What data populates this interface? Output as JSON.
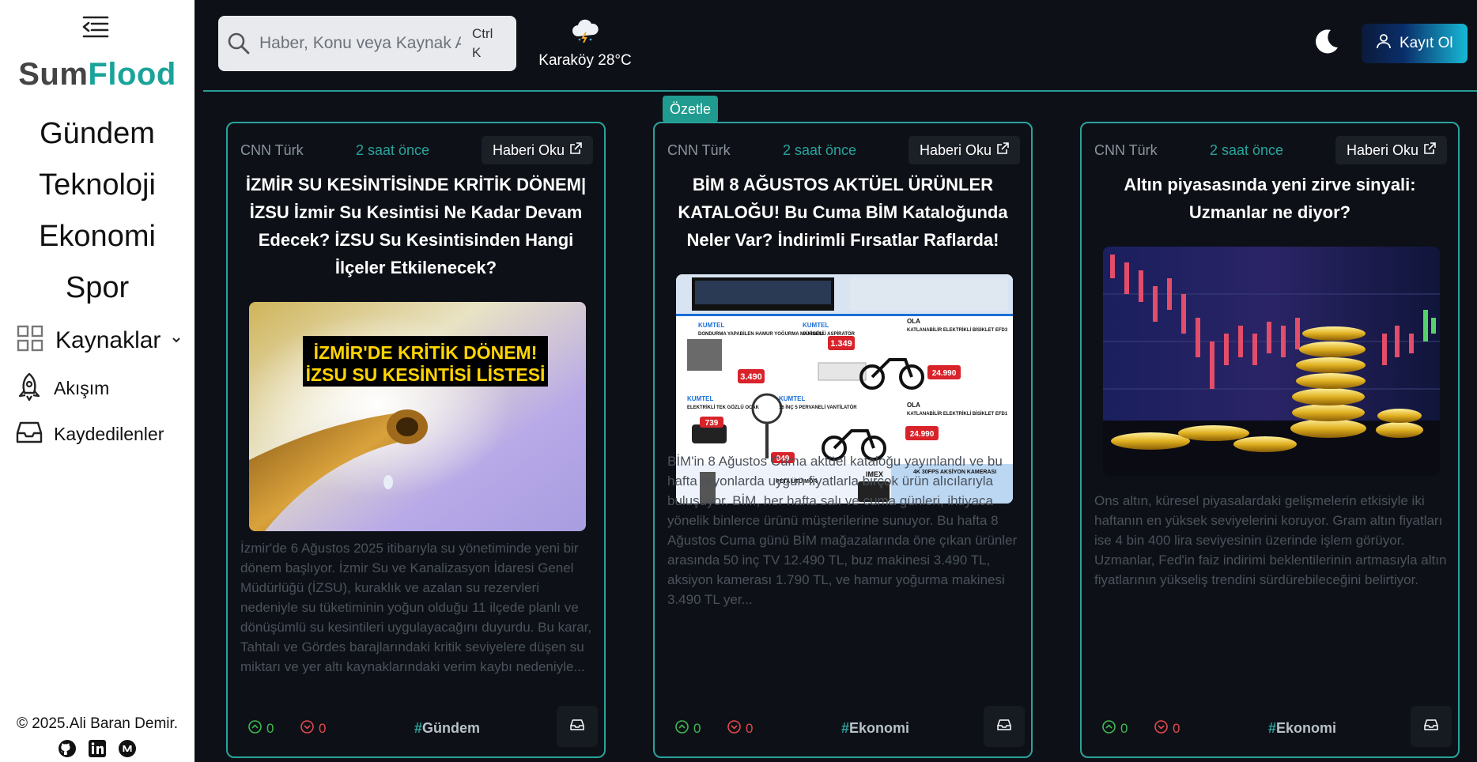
{
  "sidebar": {
    "logo_part1": "Sum",
    "logo_part2": "Flood",
    "categories": [
      "Gündem",
      "Teknoloji",
      "Ekonomi",
      "Spor"
    ],
    "sources_label": "Kaynaklar",
    "feed_label": "Akışım",
    "saved_label": "Kaydedilenler",
    "footer": "© 2025.Ali Baran Demir.",
    "social_icons": [
      "github-icon",
      "linkedin-icon",
      "medium-icon"
    ]
  },
  "header": {
    "search_placeholder": "Haber, Konu veya Kaynak Ara",
    "shortcut_line1": "Ctrl",
    "shortcut_line2": "K",
    "weather_text": "Karaköy 28°C",
    "weather_icon": "cloud-lightning-icon",
    "theme_icon": "moon-icon",
    "signup_label": "Kayıt Ol"
  },
  "summarize_label": "Özetle",
  "colors": {
    "accent": "#2aa39c",
    "background": "#0d1117",
    "upvote": "#3fb950",
    "downvote": "#e5484d"
  },
  "cards": [
    {
      "source": "CNN Türk",
      "time": "2 saat önce",
      "read_label": "Haberi Oku",
      "title": "İZMİR SU KESİNTİSİNDE KRİTİK DÖNEM| İZSU İzmir Su Kesintisi Ne Kadar Devam Edecek? İZSU Su Kesintisinden Hangi İlçeler Etkilenecek?",
      "image_caption_line1": "İZMİR'DE KRİTİK DÖNEM!",
      "image_caption_line2": "İZSU SU KESİNTİSİ LİSTESİ",
      "description": "İzmir'de 6 Ağustos 2025 itibarıyla su yönetiminde yeni bir dönem başlıyor. İzmir Su ve Kanalizasyon İdaresi Genel Müdürlüğü (İZSU), kuraklık ve azalan su rezervleri nedeniyle su tüketiminin yoğun olduğu 11 ilçede planlı ve dönüşümlü su kesintileri uygulayacağını duyurdu. Bu karar, Tahtalı ve Gördes barajlarındaki kritik seviyelere düşen su miktarı ve yer altı kaynaklarındaki verim kaybı nedeniyle...",
      "upvotes": "0",
      "downvotes": "0",
      "tag": "Gündem"
    },
    {
      "source": "CNN Türk",
      "time": "2 saat önce",
      "read_label": "Haberi Oku",
      "title": "BİM 8 AĞUSTOS AKTÜEL ÜRÜNLER KATALOĞU! Bu Cuma BİM Kataloğunda Neler Var? İndirimli Fırsatlar Raflarda!",
      "description": "BİM'in 8 Ağustos Cuma aktüel kataloğu yayınlandı ve bu hafta reyonlarda uygun fiyatlarla birçok ürün alıcılarıyla buluşuyor. BİM, her hafta salı ve cuma günleri, ihtiyaca yönelik binlerce ürünü müşterilerine sunuyor. Bu hafta 8 Ağustos Cuma günü BİM mağazalarında öne çıkan ürünler arasında 50 inç TV 12.490 TL, buz makinesi 3.490 TL, aksiyon kamerası 1.790 TL, ve hamur yoğurma makinesi 3.490 TL yer...",
      "upvotes": "0",
      "downvotes": "0",
      "tag": "Ekonomi",
      "catalog": {
        "kumtel1": "KUMTEL",
        "p1": "DONDURMA YAPABİLEN HAMUR YOĞURMA MAKİNESİ",
        "price1": "3.490",
        "kumtel2": "KUMTEL",
        "p2": "SÜRGÜLÜ ASPİRATÖR",
        "price2": "1.349",
        "ola1": "OLA",
        "p3": "KATLANABİLİR ELEKTRİKLİ BİSİKLET EFD3",
        "price3": "24.990",
        "kumtel3": "KUMTEL",
        "p4": "ELEKTRİKLİ TEK GÖZLÜ OCAK",
        "price4": "739",
        "kumtel4": "KUMTEL",
        "p5": "16 İNÇ 5 PERVANELİ VANTİLATÖR",
        "price5": "949",
        "ola2": "OLA",
        "p6": "KATLANABİLİR ELEKTRİKLİ BİSİKLET EFD1",
        "price6": "24.990",
        "p7": "PETA ÜTÜ MOR",
        "imex": "IMEX",
        "p8": "4K 30FPS AKSİYON KAMERASI"
      }
    },
    {
      "source": "CNN Türk",
      "time": "2 saat önce",
      "read_label": "Haberi Oku",
      "title": "Altın piyasasında yeni zirve sinyali: Uzmanlar ne diyor?",
      "description": "Ons altın, küresel piyasalardaki gelişmelerin etkisiyle iki haftanın en yüksek seviyelerini koruyor. Gram altın fiyatları ise 4 bin 400 lira seviyesinin üzerinde işlem görüyor. Uzmanlar, Fed'in faiz indirimi beklentilerinin artmasıyla altın fiyatlarının yükseliş trendini sürdürebileceğini belirtiyor.",
      "upvotes": "0",
      "downvotes": "0",
      "tag": "Ekonomi"
    }
  ]
}
